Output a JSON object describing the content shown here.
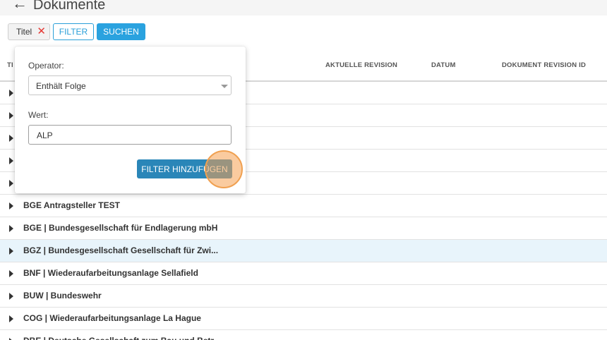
{
  "header": {
    "back_icon": "arrow-left-icon",
    "title": "Dokumente"
  },
  "filter_bar": {
    "chip_label": "Titel",
    "chip_close": "✕",
    "filter_button": "FILTER",
    "search_button": "SUCHEN"
  },
  "table": {
    "columns": {
      "title_truncated": "TI",
      "aktuelle_revision": "AKTUELLE REVISION",
      "datum": "DATUM",
      "dokument_revision_id": "DOKUMENT REVISION ID"
    },
    "rows": [
      {
        "label": ""
      },
      {
        "label": ""
      },
      {
        "label": ""
      },
      {
        "label": ""
      },
      {
        "label": ""
      },
      {
        "label": "BGE Antragsteller TEST"
      },
      {
        "label": "BGE | Bundesgesellschaft für Endlagerung mbH"
      },
      {
        "label": "BGZ | Bundesgesellschaft Gesellschaft für Zwi..."
      },
      {
        "label": "BNF | Wiederaufarbeitungsanlage Sellafield"
      },
      {
        "label": "BUW | Bundeswehr"
      },
      {
        "label": "COG | Wiederaufarbeitungsanlage La Hague"
      },
      {
        "label": "DBE | Deutsche Gesellschaft zum Bau und Betr..."
      }
    ],
    "selected_row_index": 7
  },
  "filter_popover": {
    "operator_label": "Operator:",
    "operator_value": "Enthält Folge",
    "value_label": "Wert:",
    "value_input": "ALP",
    "add_button": "FILTER HINZUFÜGEN"
  }
}
